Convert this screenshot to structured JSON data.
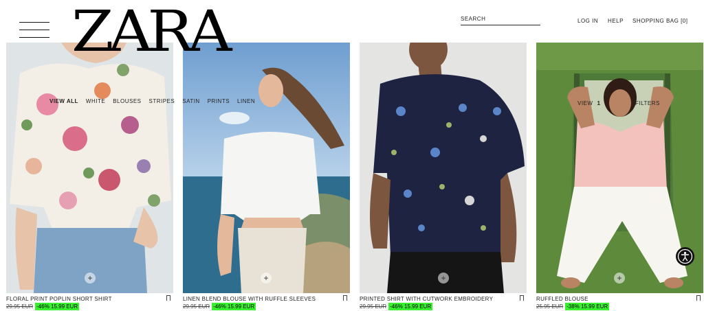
{
  "header": {
    "logo": "ZARA",
    "search_placeholder": "SEARCH",
    "login": "LOG IN",
    "help": "HELP",
    "bag": "SHOPPING BAG [0]"
  },
  "filters": [
    "VIEW ALL",
    "WHITE",
    "BLOUSES",
    "STRIPES",
    "SATIN",
    "PRINTS",
    "LINEN"
  ],
  "view": {
    "label": "VIEW",
    "value": "1",
    "filters_label": "FILTERS"
  },
  "products": [
    {
      "name": "FLORAL PRINT POPLIN SHORT SHIRT",
      "old_price": "29.95 EUR",
      "discount": "-46%",
      "price": "15.99 EUR"
    },
    {
      "name": "LINEN BLEND BLOUSE WITH RUFFLE SLEEVES",
      "old_price": "29.95 EUR",
      "discount": "-46%",
      "price": "15.99 EUR"
    },
    {
      "name": "PRINTED SHIRT WITH CUTWORK EMBROIDERY",
      "old_price": "29.95 EUR",
      "discount": "-46%",
      "price": "15.99 EUR"
    },
    {
      "name": "RUFFLED BLOUSE",
      "old_price": "25.95 EUR",
      "discount": "-38%",
      "price": "15.99 EUR"
    }
  ],
  "colors": {
    "discount_bg": "#36f12b",
    "text": "#222222"
  },
  "icons": {
    "menu": "hamburger-menu-icon",
    "bookmark": "bookmark-icon",
    "add": "plus-icon",
    "accessibility": "accessibility-icon"
  }
}
